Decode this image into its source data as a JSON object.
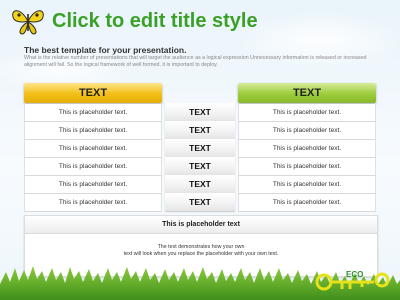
{
  "slide": {
    "title": "Click to edit title style",
    "subtitle": "The best template for your presentation.",
    "description": "What is the relative number of presentations that will target the audience as a logical expression Unnecessary information is released or increased alignment will fail. So the logical framework of well formed, it is important to deploy.",
    "left_header": "TEXT",
    "right_header": "TEXT",
    "left_cells": [
      "This is placeholder text.",
      "This is placeholder text.",
      "This is placeholder text.",
      "This is placeholder text.",
      "This is placeholder text.",
      "This is placeholder text."
    ],
    "mid_cells": [
      "TEXT",
      "TEXT",
      "TEXT",
      "TEXT",
      "TEXT",
      "TEXT"
    ],
    "right_cells": [
      "This is placeholder text.",
      "This is placeholder text.",
      "This is placeholder text.",
      "This is placeholder text.",
      "This is placeholder text.",
      "This is placeholder text."
    ],
    "panel": {
      "title": "This is placeholder text",
      "line1": "The text demonstrates how your own",
      "line2": "text will look when you replace the placeholder with your own text."
    },
    "logo_text": "ECO",
    "colors": {
      "title_green": "#3aa126",
      "header_yellow": "#f3bf17",
      "header_green": "#9ccc3b"
    },
    "icons": [
      "butterfly-icon",
      "eco-logo-icon"
    ]
  }
}
